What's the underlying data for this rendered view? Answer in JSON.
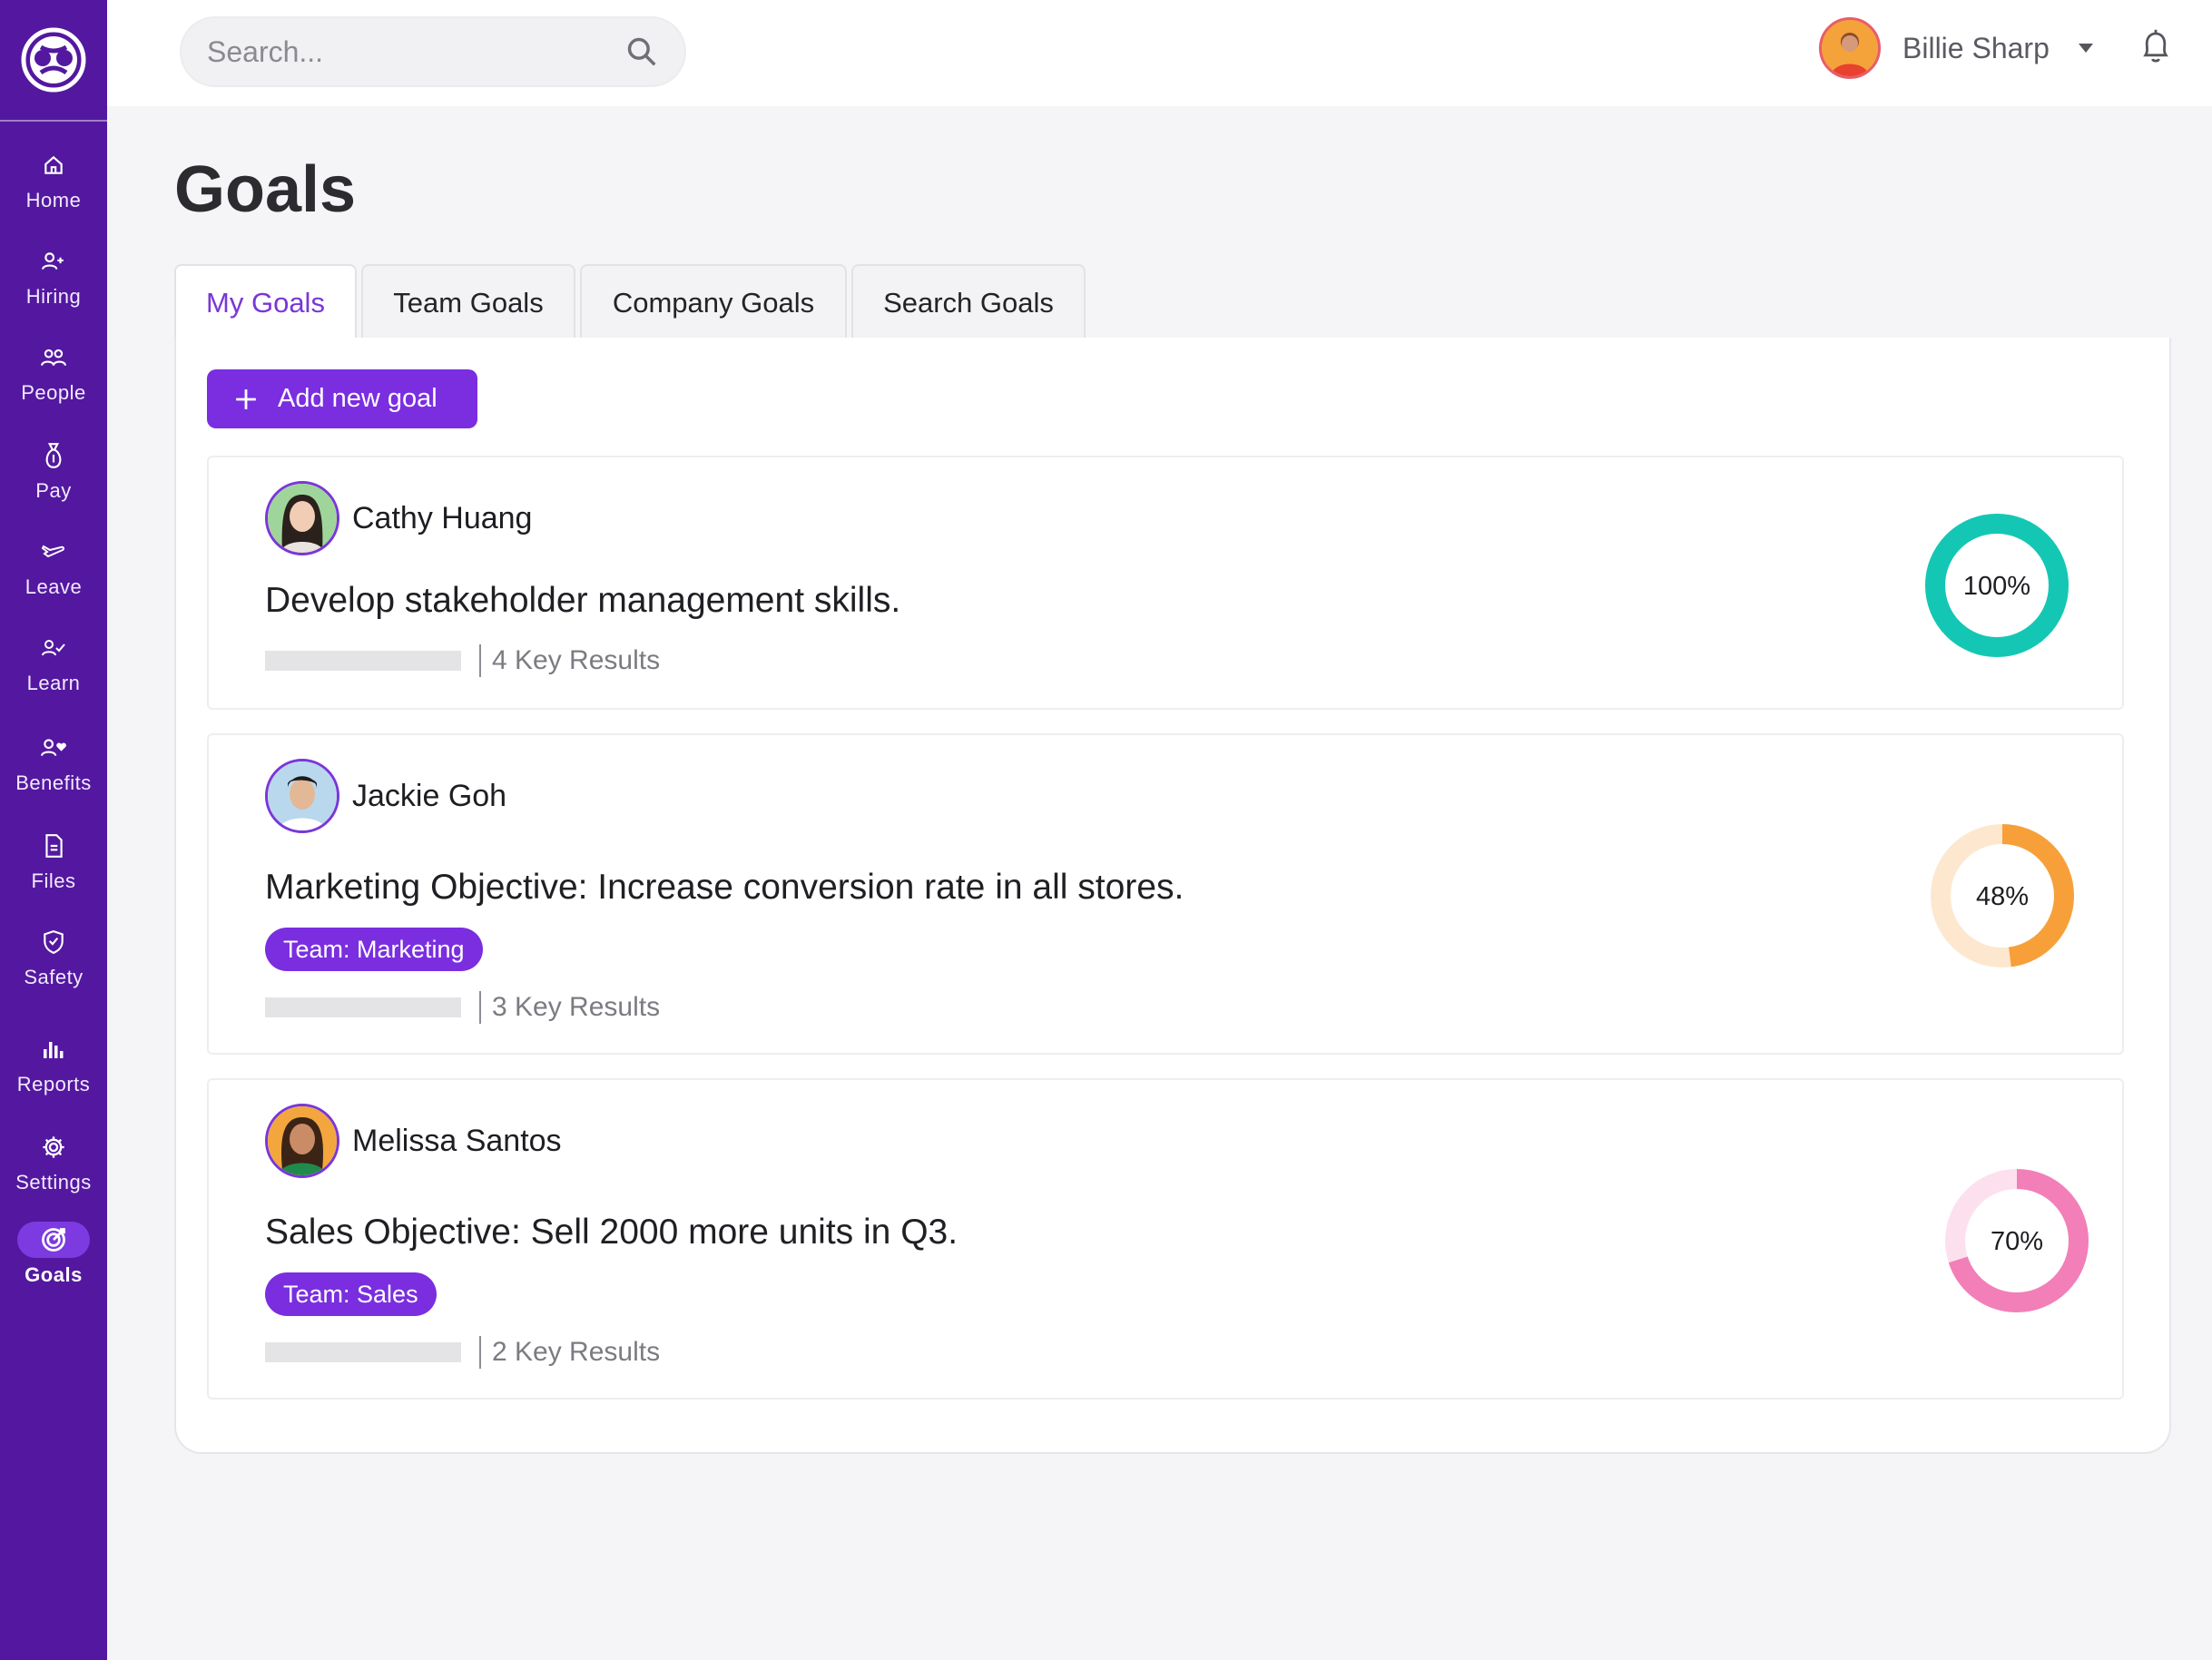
{
  "app": {
    "nav": [
      {
        "label": "Home"
      },
      {
        "label": "Hiring"
      },
      {
        "label": "People"
      },
      {
        "label": "Pay"
      },
      {
        "label": "Leave"
      },
      {
        "label": "Learn"
      },
      {
        "label": "Benefits"
      },
      {
        "label": "Files"
      },
      {
        "label": "Safety"
      },
      {
        "label": "Reports"
      },
      {
        "label": "Settings"
      },
      {
        "label": "Goals",
        "active": true
      }
    ]
  },
  "search": {
    "placeholder": "Search..."
  },
  "user": {
    "name": "Billie Sharp"
  },
  "page": {
    "title": "Goals"
  },
  "tabs": [
    {
      "label": "My Goals",
      "active": true
    },
    {
      "label": "Team Goals"
    },
    {
      "label": "Company Goals"
    },
    {
      "label": "Search Goals"
    }
  ],
  "actions": {
    "add_goal_label": "Add new goal"
  },
  "goals": [
    {
      "owner": "Cathy Huang",
      "title": "Develop stakeholder management skills.",
      "team": "",
      "key_results": "4 Key Results",
      "progress": 100,
      "progress_label": "100%",
      "color": "#14c7b4",
      "track_color": "#bff0ea"
    },
    {
      "owner": "Jackie Goh",
      "title": "Marketing Objective: Increase conversion rate in all stores.",
      "team": "Team: Marketing",
      "key_results": "3 Key Results",
      "progress": 48,
      "progress_label": "48%",
      "color": "#f7a03a",
      "track_color": "#fde8cf"
    },
    {
      "owner": "Melissa Santos",
      "title": "Sales Objective: Sell 2000 more units in Q3.",
      "team": "Team: Sales",
      "key_results": "2 Key Results",
      "progress": 70,
      "progress_label": "70%",
      "color": "#f27fb8",
      "track_color": "#fde0ee"
    }
  ],
  "colors": {
    "sidebar": "#53189f",
    "accent": "#7a2ee0",
    "tab_active_text": "#7a36d8"
  }
}
